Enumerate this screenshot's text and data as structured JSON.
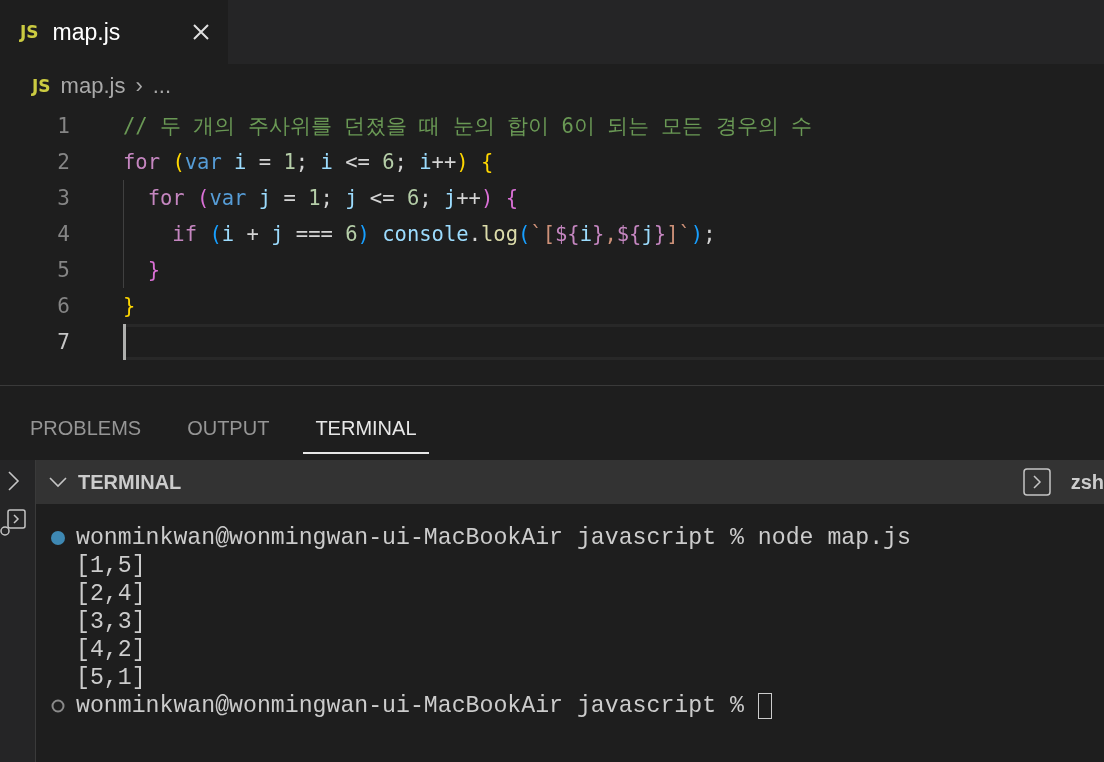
{
  "editor_tabs": [
    {
      "icon_label": "JS",
      "label": "map.js",
      "selected": true
    }
  ],
  "breadcrumb": {
    "icon_label": "JS",
    "file": "map.js",
    "separator": "›",
    "rest": "..."
  },
  "code_lines": [
    {
      "number": "1",
      "current": false,
      "tokens": [
        {
          "kind": "comment",
          "text": "// 두 개의 주사위를 던졌을 때 눈의 합이 6이 되는 모든 경우의 수"
        }
      ]
    },
    {
      "number": "2",
      "current": false,
      "tokens": [
        {
          "kind": "keyword",
          "text": "for "
        },
        {
          "kind": "bracket1",
          "text": "("
        },
        {
          "kind": "storage",
          "text": "var "
        },
        {
          "kind": "variable",
          "text": "i"
        },
        {
          "kind": "plain",
          "text": " = "
        },
        {
          "kind": "number",
          "text": "1"
        },
        {
          "kind": "plain",
          "text": "; "
        },
        {
          "kind": "variable",
          "text": "i"
        },
        {
          "kind": "plain",
          "text": " <= "
        },
        {
          "kind": "number",
          "text": "6"
        },
        {
          "kind": "plain",
          "text": "; "
        },
        {
          "kind": "variable",
          "text": "i"
        },
        {
          "kind": "plain",
          "text": "++"
        },
        {
          "kind": "bracket1",
          "text": ") {"
        }
      ]
    },
    {
      "number": "3",
      "current": false,
      "guide": true,
      "tokens": [
        {
          "kind": "keyword",
          "text": "  for "
        },
        {
          "kind": "bracket2",
          "text": "("
        },
        {
          "kind": "storage",
          "text": "var "
        },
        {
          "kind": "variable",
          "text": "j"
        },
        {
          "kind": "plain",
          "text": " = "
        },
        {
          "kind": "number",
          "text": "1"
        },
        {
          "kind": "plain",
          "text": "; "
        },
        {
          "kind": "variable",
          "text": "j"
        },
        {
          "kind": "plain",
          "text": " <= "
        },
        {
          "kind": "number",
          "text": "6"
        },
        {
          "kind": "plain",
          "text": "; "
        },
        {
          "kind": "variable",
          "text": "j"
        },
        {
          "kind": "plain",
          "text": "++"
        },
        {
          "kind": "bracket2",
          "text": ") {"
        }
      ]
    },
    {
      "number": "4",
      "current": false,
      "guide": true,
      "tokens": [
        {
          "kind": "keyword",
          "text": "    if "
        },
        {
          "kind": "bracket3",
          "text": "("
        },
        {
          "kind": "variable",
          "text": "i"
        },
        {
          "kind": "plain",
          "text": " + "
        },
        {
          "kind": "variable",
          "text": "j"
        },
        {
          "kind": "plain",
          "text": " === "
        },
        {
          "kind": "number",
          "text": "6"
        },
        {
          "kind": "bracket3",
          "text": ") "
        },
        {
          "kind": "variable",
          "text": "console"
        },
        {
          "kind": "plain",
          "text": "."
        },
        {
          "kind": "function",
          "text": "log"
        },
        {
          "kind": "bracket3",
          "text": "("
        },
        {
          "kind": "string",
          "text": "`["
        },
        {
          "kind": "keyword",
          "text": "${"
        },
        {
          "kind": "variable",
          "text": "i"
        },
        {
          "kind": "keyword",
          "text": "}"
        },
        {
          "kind": "string",
          "text": ","
        },
        {
          "kind": "keyword",
          "text": "${"
        },
        {
          "kind": "variable",
          "text": "j"
        },
        {
          "kind": "keyword",
          "text": "}"
        },
        {
          "kind": "string",
          "text": "]`"
        },
        {
          "kind": "bracket3",
          "text": ")"
        },
        {
          "kind": "plain",
          "text": ";"
        }
      ]
    },
    {
      "number": "5",
      "current": false,
      "guide": true,
      "tokens": [
        {
          "kind": "bracket2",
          "text": "  }"
        }
      ]
    },
    {
      "number": "6",
      "current": false,
      "tokens": [
        {
          "kind": "bracket1",
          "text": "}"
        }
      ]
    },
    {
      "number": "7",
      "current": true
    }
  ],
  "panel_tabs": [
    {
      "label": "PROBLEMS",
      "selected": false
    },
    {
      "label": "OUTPUT",
      "selected": false
    },
    {
      "label": "TERMINAL",
      "selected": true
    }
  ],
  "terminal_header": {
    "title": "TERMINAL",
    "shell": "zsh"
  },
  "terminal_lines": [
    {
      "kind": "prompt",
      "succeeded": true,
      "text": "wonminkwan@wonmingwan-ui-MacBookAir javascript % node map.js"
    },
    {
      "kind": "output",
      "text": "[1,5]"
    },
    {
      "kind": "output",
      "text": "[2,4]"
    },
    {
      "kind": "output",
      "text": "[3,3]"
    },
    {
      "kind": "output",
      "text": "[4,2]"
    },
    {
      "kind": "output",
      "text": "[5,1]"
    },
    {
      "kind": "prompt",
      "succeeded": false,
      "text": "wonminkwan@wonmingwan-ui-MacBookAir javascript %",
      "cursor": true
    }
  ]
}
